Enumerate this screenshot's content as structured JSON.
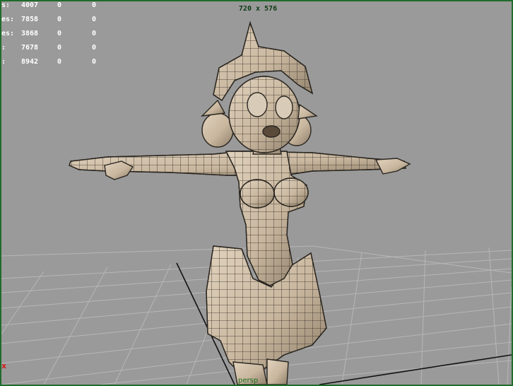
{
  "viewport": {
    "resolution": "720 x 576",
    "camera_label": "persp",
    "axis_label": "x"
  },
  "hud": {
    "rows": [
      {
        "label": "s:",
        "v1": "4007",
        "v2": "0",
        "v3": "0"
      },
      {
        "label": "es:",
        "v1": "7858",
        "v2": "0",
        "v3": "0"
      },
      {
        "label": "es:",
        "v1": "3868",
        "v2": "0",
        "v3": "0"
      },
      {
        "label": ":",
        "v1": "7678",
        "v2": "0",
        "v3": "0"
      },
      {
        "label": ":",
        "v1": "8942",
        "v2": "0",
        "v3": "0"
      }
    ]
  },
  "colors": {
    "background": "#9a9a9a",
    "grid": "#b7b7b7",
    "mesh_fill": "#c8b7a0",
    "wire": "#2a2620",
    "border": "#1f6b2a"
  }
}
